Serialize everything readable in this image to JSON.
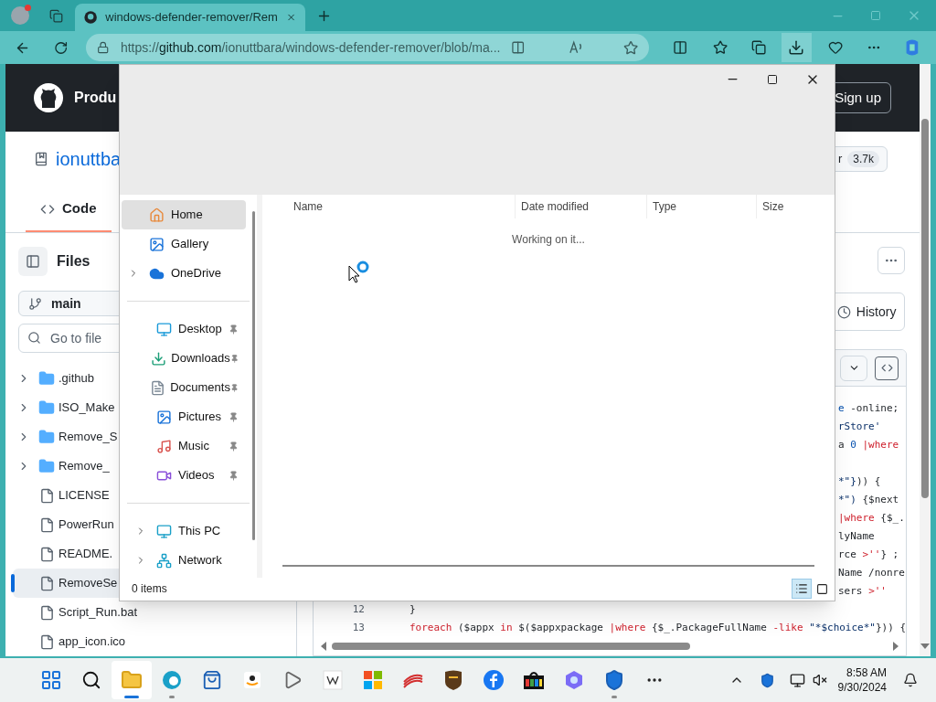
{
  "browser": {
    "tab_title": "windows-defender-remover/Rem",
    "url": "https://**github.com**/ionuttbara/windows-defender-remover/blob/ma..."
  },
  "github": {
    "nav_partial": "Produ",
    "sign_up": "Sign up",
    "repo_partial": "ionuttba",
    "star_partial": "r",
    "star_count": "3.7k",
    "tabs": [
      {
        "label": "Code",
        "selected": true
      }
    ],
    "files_title": "Files",
    "branch": "main",
    "search_placeholder": "Go to file",
    "tree": [
      {
        "name": ".github",
        "kind": "folder",
        "selected": false
      },
      {
        "name": "ISO_Make",
        "kind": "folder",
        "selected": false
      },
      {
        "name": "Remove_S",
        "kind": "folder",
        "selected": false
      },
      {
        "name": "Remove_",
        "kind": "folder",
        "selected": false
      },
      {
        "name": "LICENSE",
        "kind": "file",
        "selected": false
      },
      {
        "name": "PowerRun",
        "kind": "file",
        "selected": false
      },
      {
        "name": "README.",
        "kind": "file",
        "selected": false
      },
      {
        "name": "RemoveSe",
        "kind": "file",
        "selected": true
      },
      {
        "name": "Script_Run.bat",
        "kind": "file",
        "selected": false
      },
      {
        "name": "app_icon.ico",
        "kind": "file",
        "selected": false
      }
    ],
    "history": "History",
    "code_lines": [
      {
        "kind": "partial",
        "segments": [
          {
            "text": "e",
            "kind": "number"
          },
          {
            "text": " -online;",
            "kind": "plain"
          }
        ]
      },
      {
        "kind": "partial",
        "segments": [
          {
            "text": "rStore'",
            "kind": "string"
          }
        ]
      },
      {
        "kind": "partial",
        "segments": [
          {
            "text": "a ",
            "kind": "plain"
          },
          {
            "text": "0",
            "kind": "number"
          },
          {
            "text": " |where",
            "kind": "keyword"
          }
        ]
      },
      {
        "kind": "hidden"
      },
      {
        "kind": "partial",
        "segments": [
          {
            "text": "*\"}",
            "kind": "string"
          },
          {
            "text": ")) {",
            "kind": "plain"
          }
        ]
      },
      {
        "kind": "partial",
        "segments": [
          {
            "text": "*\")",
            "kind": "string"
          },
          {
            "text": " {$next",
            "kind": "plain"
          }
        ]
      },
      {
        "kind": "partial",
        "segments": [
          {
            "text": "|where",
            "kind": "keyword"
          },
          {
            "text": " {$_.",
            "kind": "plain"
          }
        ]
      },
      {
        "kind": "partial",
        "segments": [
          {
            "text": "lyName",
            "kind": "plain"
          }
        ]
      },
      {
        "kind": "partial",
        "segments": [
          {
            "text": "rce ",
            "kind": "plain"
          },
          {
            "text": ">''",
            "kind": "keyword"
          },
          {
            "text": "} ;",
            "kind": "plain"
          }
        ]
      },
      {
        "kind": "partial",
        "segments": [
          {
            "text": "Name /nonre",
            "kind": "plain"
          }
        ]
      },
      {
        "kind": "partial",
        "segments": [
          {
            "text": "sers ",
            "kind": "plain"
          },
          {
            "text": ">''",
            "kind": "keyword"
          }
        ]
      },
      {
        "kind": "full",
        "number": "12",
        "segments": [
          {
            "text": "}",
            "kind": "plain"
          }
        ]
      },
      {
        "kind": "full",
        "number": "13",
        "segments": [
          {
            "text": "foreach",
            "kind": "keyword"
          },
          {
            "text": " ($appx ",
            "kind": "plain"
          },
          {
            "text": "in",
            "kind": "keyword"
          },
          {
            "text": " $($appxpackage ",
            "kind": "plain"
          },
          {
            "text": "|where",
            "kind": "keyword"
          },
          {
            "text": " {$_.PackageFullName ",
            "kind": "plain"
          },
          {
            "text": "-like",
            "kind": "keyword"
          },
          {
            "text": " \"*$choice*\"",
            "kind": "string"
          },
          {
            "text": "})) {",
            "kind": "plain"
          }
        ]
      }
    ]
  },
  "dialog": {
    "sections": [
      {
        "items": [
          {
            "label": "Home",
            "kind": "home",
            "selected": true,
            "expandable": false,
            "pinned": false
          },
          {
            "label": "Gallery",
            "kind": "gallery",
            "selected": false,
            "expandable": false,
            "pinned": false
          },
          {
            "label": "OneDrive",
            "kind": "cloud",
            "selected": false,
            "expandable": true,
            "pinned": false
          }
        ]
      },
      {
        "items": [
          {
            "label": "Desktop",
            "kind": "desktop",
            "selected": false,
            "expandable": false,
            "pinned": true
          },
          {
            "label": "Downloads",
            "kind": "downloads",
            "selected": false,
            "expandable": false,
            "pinned": true
          },
          {
            "label": "Documents",
            "kind": "documents",
            "selected": false,
            "expandable": false,
            "pinned": true
          },
          {
            "label": "Pictures",
            "kind": "pictures",
            "selected": false,
            "expandable": false,
            "pinned": true
          },
          {
            "label": "Music",
            "kind": "music",
            "selected": false,
            "expandable": false,
            "pinned": true
          },
          {
            "label": "Videos",
            "kind": "videos",
            "selected": false,
            "expandable": false,
            "pinned": true
          }
        ]
      },
      {
        "items": [
          {
            "label": "This PC",
            "kind": "pc",
            "selected": false,
            "expandable": true,
            "pinned": false
          },
          {
            "label": "Network",
            "kind": "network",
            "selected": false,
            "expandable": true,
            "pinned": false
          }
        ]
      }
    ],
    "columns": [
      "Name",
      "Date modified",
      "Type",
      "Size"
    ],
    "message": "Working on it...",
    "status": "0 items",
    "views": [
      {
        "kind": "details",
        "selected": true
      },
      {
        "kind": "tiles",
        "selected": false
      }
    ]
  },
  "taskbar": {
    "apps": [
      {
        "kind": "start",
        "running": false,
        "active": false
      },
      {
        "kind": "search",
        "running": false,
        "active": false
      },
      {
        "kind": "explorer",
        "running": true,
        "active": true
      },
      {
        "kind": "edge",
        "running": true,
        "active": false
      },
      {
        "kind": "store",
        "running": false,
        "active": false
      },
      {
        "kind": "amazon",
        "running": false,
        "active": false
      },
      {
        "kind": "media",
        "running": false,
        "active": false
      },
      {
        "kind": "wiki",
        "running": false,
        "active": false
      },
      {
        "kind": "tiles",
        "running": false,
        "active": false
      },
      {
        "kind": "bank",
        "running": false,
        "active": false
      },
      {
        "kind": "ups",
        "running": false,
        "active": false
      },
      {
        "kind": "facebook",
        "running": false,
        "active": false
      },
      {
        "kind": "bag",
        "running": false,
        "active": false
      },
      {
        "kind": "copilot",
        "running": false,
        "active": false
      },
      {
        "kind": "shield",
        "running": true,
        "active": false
      },
      {
        "kind": "more",
        "running": false,
        "active": false
      }
    ],
    "time": "8:58 AM",
    "date": "9/30/2024"
  }
}
